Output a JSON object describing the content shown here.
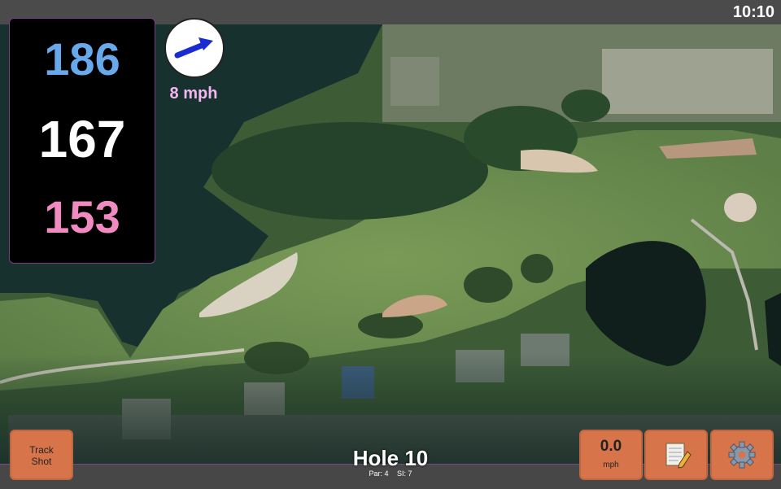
{
  "status": {
    "time": "10:10"
  },
  "distances": {
    "back": "186",
    "middle": "167",
    "front": "153"
  },
  "wind": {
    "speed": "8 mph",
    "direction_icon": "wind-arrow-icon"
  },
  "buttons": {
    "track_shot": [
      "Track",
      "Shot"
    ],
    "speed_value": "0.0",
    "speed_unit": "mph",
    "notes_icon": "notepad-icon",
    "settings_icon": "gear-icon"
  },
  "hole": {
    "title": "Hole 10",
    "par": "Par: 4",
    "si": "SI: 7"
  },
  "colors": {
    "back_distance": "#68a9ec",
    "middle_distance": "#ffffff",
    "front_distance": "#f08ac0",
    "button": "#d7744a",
    "wind_text": "#f4b6f0"
  }
}
